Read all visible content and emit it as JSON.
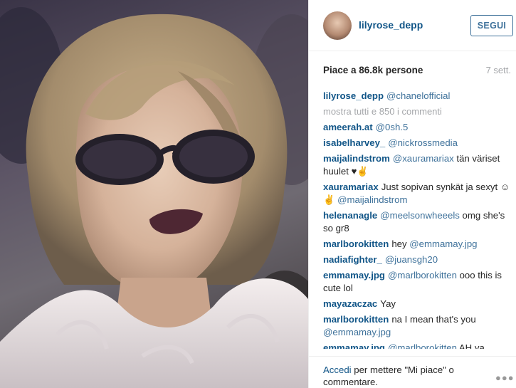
{
  "post": {
    "username": "lilyrose_depp",
    "follow_label": "SEGUI",
    "likes": "Piace a 86.8k persone",
    "time_ago": "7 sett."
  },
  "comments": [
    {
      "user": "lilyrose_depp",
      "text": "@chanelofficial"
    },
    {
      "show_all": "mostra tutti e 850 i commenti"
    },
    {
      "user": "ameerah.at",
      "text": "@0sh.5"
    },
    {
      "user": "isabelharvey_",
      "text": "@nickrossmedia"
    },
    {
      "user": "maijalindstrom",
      "text": "@xauramariax tän väriset huulet ♥✌"
    },
    {
      "user": "xauramariax",
      "text": "Just sopivan synkät ja sexyt ☺✌ @maijalindstrom"
    },
    {
      "user": "helenanagle",
      "text": "@meelsonwheeels omg she's so gr8"
    },
    {
      "user": "marlborokitten",
      "text": "hey @emmamay.jpg"
    },
    {
      "user": "nadiafighter_",
      "text": "@juansgh20"
    },
    {
      "user": "emmamay.jpg",
      "text": "@marlborokitten ooo this is cute lol"
    },
    {
      "user": "mayazaczac",
      "text": "Yay"
    },
    {
      "user": "marlborokitten",
      "text": "na I mean that's you @emmamay.jpg"
    },
    {
      "user": "emmamay.jpg",
      "text": "@marlborokitten AH ya"
    }
  ],
  "footer": {
    "login_link": "Accedi",
    "login_text": "per mettere \"Mi piace\" o commentare.",
    "more_icon": "more-options-icon"
  },
  "colors": {
    "username_blue": "#125688",
    "button_blue": "#3f729b",
    "muted_gray": "#a5a7aa"
  }
}
